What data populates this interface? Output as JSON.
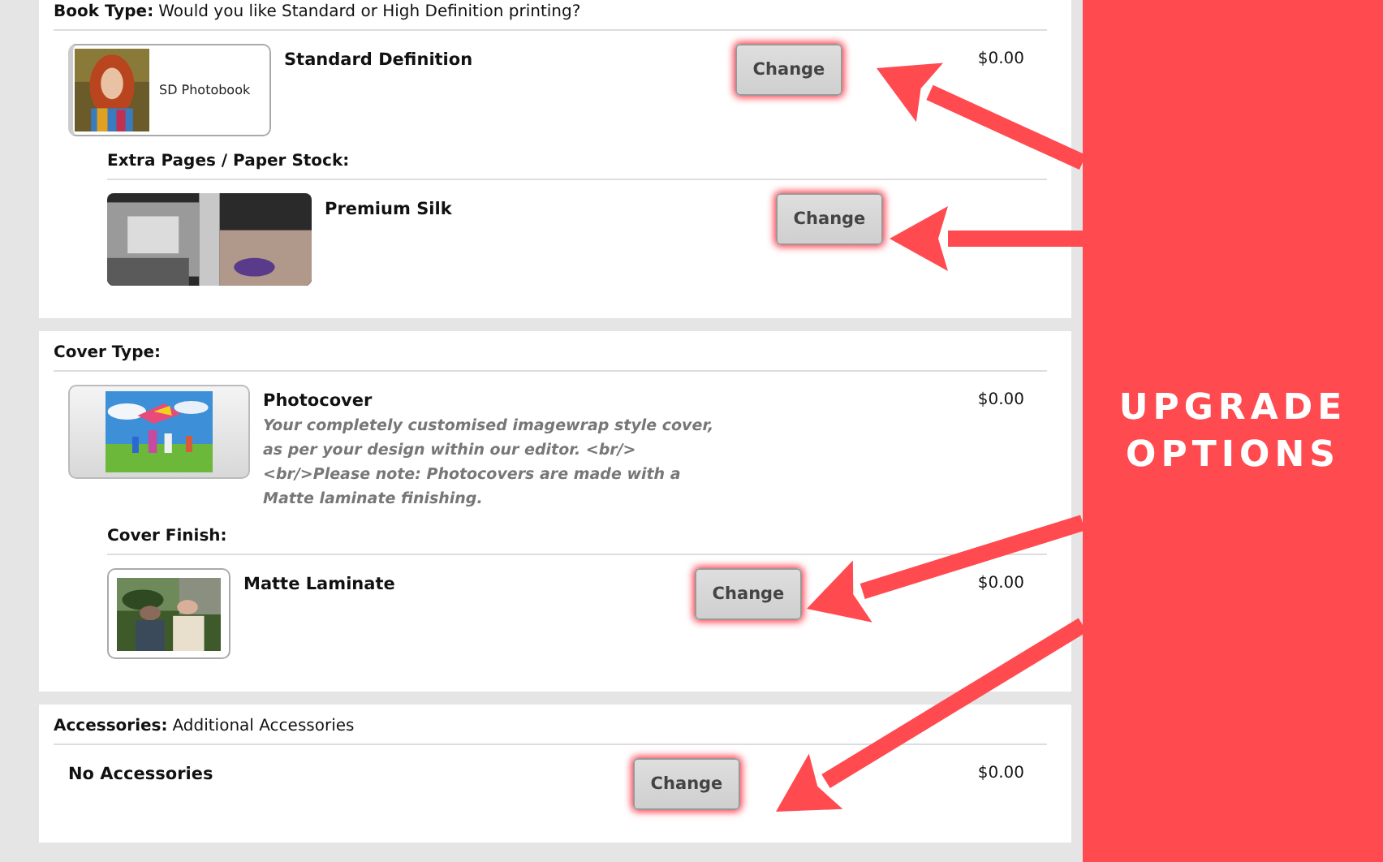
{
  "sections": [
    {
      "label": "Book Type:",
      "note": "Would you like Standard or High Definition printing?",
      "option": {
        "kind": "book",
        "caption": "SD Photobook",
        "title": "Standard Definition",
        "button": "Change",
        "price": "$0.00"
      },
      "sub": {
        "label": "Extra Pages / Paper Stock:",
        "option": {
          "title": "Premium Silk",
          "button": "Change"
        }
      }
    },
    {
      "label": "Cover Type:",
      "option": {
        "kind": "cover",
        "title": "Photocover",
        "description": "Your completely customised imagewrap style cover, as per your design within our editor. <br/> <br/>Please note: Photocovers are made with a Matte laminate finishing.",
        "price": "$0.00"
      },
      "sub": {
        "label": "Cover Finish:",
        "option": {
          "kind": "framed",
          "title": "Matte Laminate",
          "button": "Change",
          "price": "$0.00"
        }
      }
    },
    {
      "label": "Accessories:",
      "note": "Additional Accessories",
      "option": {
        "title": "No Accessories",
        "button": "Change",
        "price": "$0.00"
      }
    }
  ],
  "callout": "UPGRADE OPTIONS"
}
